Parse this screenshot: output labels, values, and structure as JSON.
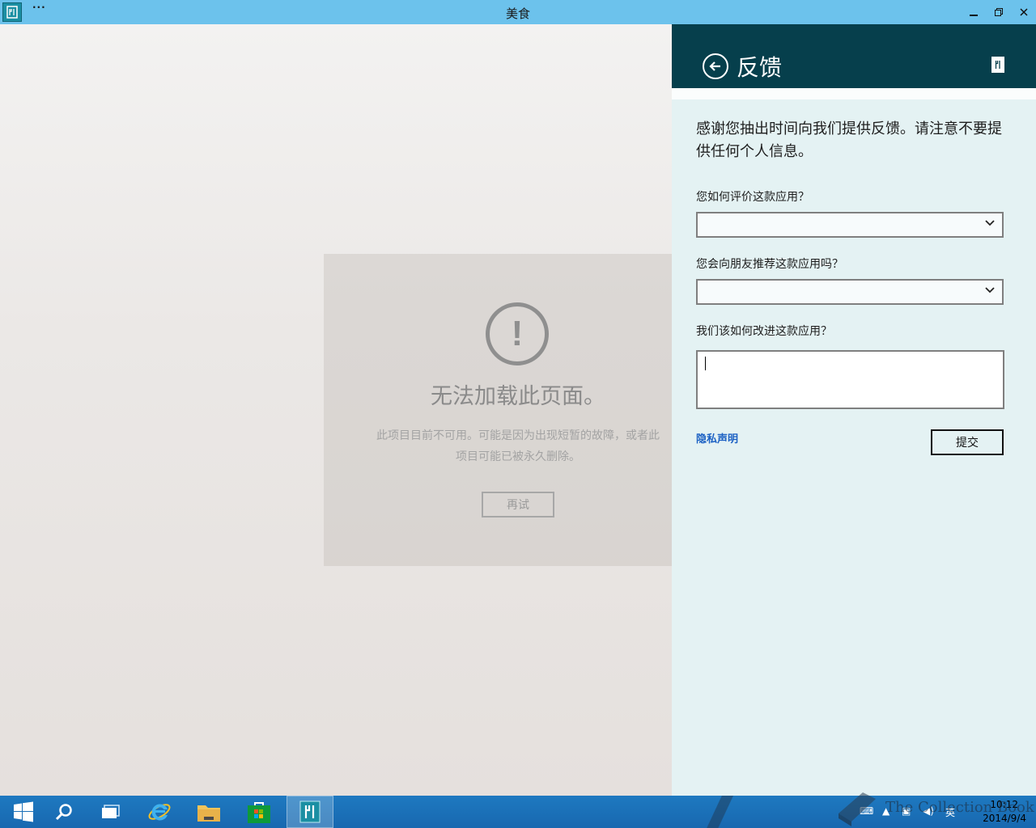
{
  "window": {
    "title": "美食",
    "menu_dots": "···",
    "buttons": {
      "minimize": "▁",
      "restore": "❐",
      "close": "✕"
    }
  },
  "error_page": {
    "icon_glyph": "!",
    "title": "无法加载此页面。",
    "description": "此项目目前不可用。可能是因为出现短暂的故障，或者此项目可能已被永久删除。",
    "retry_label": "再试"
  },
  "feedback": {
    "title": "反馈",
    "intro": "感谢您抽出时间向我们提供反馈。请注意不要提供任何个人信息。",
    "questions": [
      {
        "label": "您如何评价这款应用？",
        "value": ""
      },
      {
        "label": "您会向朋友推荐这款应用吗？",
        "value": ""
      },
      {
        "label": "我们该如何改进这款应用？",
        "value": ""
      }
    ],
    "privacy_link": "隐私声明",
    "submit_label": "提交"
  },
  "taskbar": {
    "items": [
      "start",
      "search",
      "task-view",
      "internet-explorer",
      "file-explorer",
      "store",
      "food-app"
    ],
    "tray": {
      "ime": "英"
    },
    "clock": {
      "time": "10:12",
      "date": "2014/9/4"
    }
  },
  "watermark": "The Collection Book",
  "colors": {
    "titlebar": "#6cc2ec",
    "flyout_header": "#063f4c",
    "flyout_bg": "#e4f2f3",
    "taskbar": "#1a6fb6",
    "link": "#1d62c4"
  }
}
